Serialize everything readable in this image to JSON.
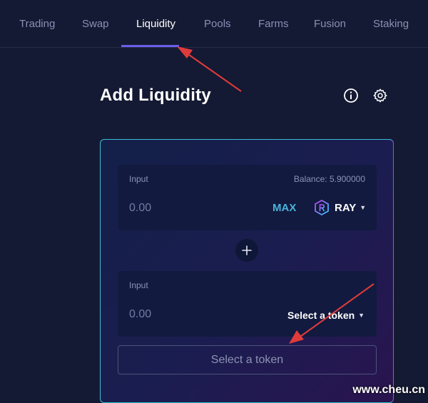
{
  "nav": {
    "tabs": [
      {
        "label": "Trading"
      },
      {
        "label": "Swap"
      },
      {
        "label": "Liquidity",
        "active": true
      },
      {
        "label": "Pools"
      },
      {
        "label": "Farms"
      },
      {
        "label": "Fusion"
      },
      {
        "label": "Staking"
      }
    ]
  },
  "page": {
    "title": "Add Liquidity",
    "info_icon": "info-circle-icon",
    "settings_icon": "gear-icon"
  },
  "input_a": {
    "label": "Input",
    "balance": "Balance: 5.900000",
    "value": "0.00",
    "max_label": "MAX",
    "token": "RAY",
    "token_icon": "ray-logo-icon"
  },
  "add_icon": "plus-icon",
  "input_b": {
    "label": "Input",
    "value": "0.00",
    "token_placeholder": "Select a token"
  },
  "action_button": "Select a token",
  "watermark": "www.cheu.cn",
  "colors": {
    "background": "#141a33",
    "accent": "#6a5ee8",
    "max": "#4ab3d8",
    "annotation_arrow": "#e03b3b"
  }
}
